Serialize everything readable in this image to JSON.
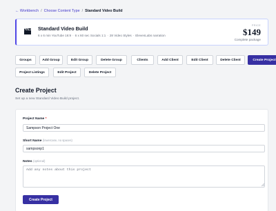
{
  "breadcrumb": {
    "back": "← Workbench",
    "sep1": "/",
    "content_type": "Choose Content Type",
    "sep2": "/",
    "current": "Standard Video Build"
  },
  "hero": {
    "icon": "film-clapper-icon",
    "title": "Standard Video Build",
    "meta": [
      "6 x 6 min YouTube 16:9",
      "·",
      "6 x 60 sec Socials 1:1",
      "·",
      "28 Video Styles",
      "·",
      "ElevenLabs narration"
    ],
    "price_label": "PRICE",
    "price": "$149",
    "price_sub": "Complete package"
  },
  "actions": [
    "Groups",
    "Add Group",
    "Edit Group",
    "Delete Group",
    "Clients",
    "Add Client",
    "Edit Client",
    "Delete Client",
    "Create Project",
    "Project Listings",
    "Edit Project",
    "Delete Project"
  ],
  "active_action": "Create Project",
  "form": {
    "title": "Create Project",
    "subtitle": "Set up a new Standard Video Build project.",
    "project_name_label": "Project Name",
    "project_name_required": "*",
    "project_name_value": "Sampson Project One",
    "short_name_label": "Short Name",
    "short_name_hint": "(lowercase, no spaces)",
    "short_name_value": "sampsonp1",
    "notes_label": "Notes",
    "notes_hint": "(optional)",
    "notes_placeholder": "Add any notes about this project",
    "submit_label": "Create Project"
  },
  "colors": {
    "accent": "#3730a3",
    "link": "#4338ca",
    "background": "#f3f4f6"
  }
}
